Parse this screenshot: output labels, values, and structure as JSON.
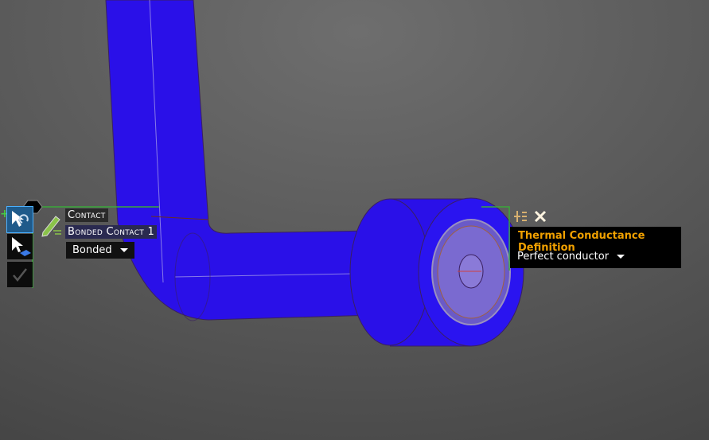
{
  "contact_panel": {
    "title": "Contact",
    "name": "Bonded Contact 1",
    "type_selected": "Bonded"
  },
  "thermal_panel": {
    "title": "Thermal Conductance Definition",
    "selected": "Perfect conductor"
  },
  "toolbar": {
    "icons": [
      "select-swap-icon",
      "select-face-icon",
      "checkmark-icon"
    ]
  },
  "colors": {
    "geometry": "#2a10e8",
    "accent": "#f0a000",
    "selection_outline": "#3aa83a",
    "active_tool": "#1f5a8a"
  }
}
